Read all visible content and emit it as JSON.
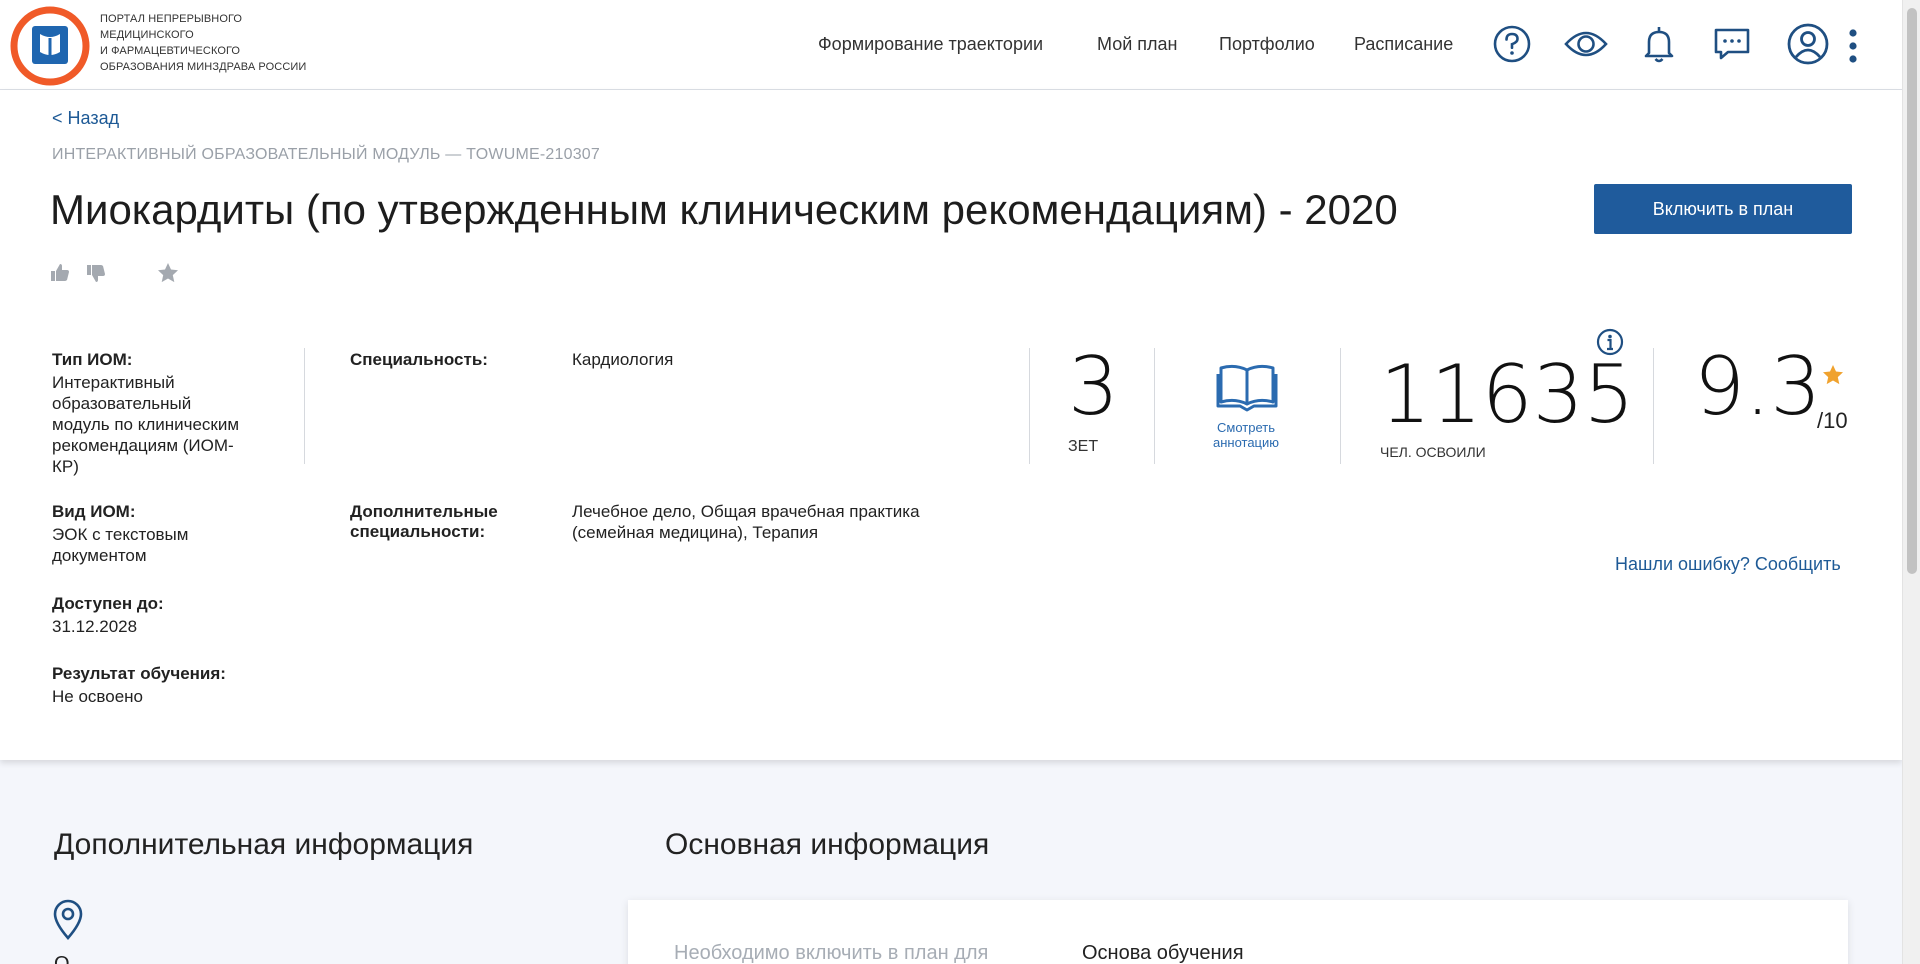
{
  "header": {
    "logo_lines": [
      "ПОРТАЛ НЕПРЕРЫВНОГО",
      "МЕДИЦИНСКОГО",
      "И ФАРМАЦЕВТИЧЕСКОГО",
      "ОБРАЗОВАНИЯ МИНЗДРАВА РОССИИ"
    ],
    "nav": [
      "Формирование траектории",
      "Мой план",
      "Портфолио",
      "Расписание"
    ],
    "icons": [
      "help-icon",
      "eye-icon",
      "bell-icon",
      "chat-icon",
      "user-icon",
      "more-vertical-icon"
    ]
  },
  "page": {
    "back": "< Назад",
    "subtitle": "ИНТЕРАКТИВНЫЙ ОБРАЗОВАТЕЛЬНЫЙ МОДУЛЬ  —  TOWUME-210307",
    "title": "Миокардиты (по утвержденным клиническим рекомендациям) - 2020",
    "include_button": "Включить в план"
  },
  "details": {
    "type_label": "Тип ИОМ:",
    "type_value": [
      "Интерактивный",
      "образовательный",
      "модуль по клиническим",
      "рекомендациям (ИОМ-",
      "КР)"
    ],
    "kind_label": "Вид ИОМ:",
    "kind_value": [
      "ЭОК с текстовым",
      "документом"
    ],
    "available_label": "Доступен до:",
    "available_value": "31.12.2028",
    "result_label": "Результат обучения:",
    "result_value": "Не освоено",
    "specialty_label": "Специальность:",
    "specialty_value": "Кардиология",
    "extra_specialty_label": [
      "Дополнительные",
      "специальности:"
    ],
    "extra_specialty_value": [
      "Лечебное дело, Общая врачебная практика",
      "(семейная медицина), Терапия"
    ]
  },
  "stats": {
    "zet_value": "3",
    "zet_label": "ЗЕТ",
    "annotation_label": [
      "Смотреть",
      "аннотацию"
    ],
    "mastered_value": "11635",
    "mastered_label": "ЧЕЛ. ОСВОИЛИ",
    "rating_value": "9.3",
    "rating_max": "/10",
    "report_error": "Нашли ошибку? Сообщить"
  },
  "lower": {
    "additional_title": "Дополнительная информация",
    "main_title": "Основная информация",
    "info_left": "Необходимо включить в план для",
    "info_right": "Основа обучения",
    "cut_text": "О"
  },
  "colors": {
    "primary": "#1f5b9c",
    "link": "#1e5a96",
    "star": "#f0a22e",
    "logo_orange": "#f05a28",
    "logo_blue": "#1f66b0"
  }
}
